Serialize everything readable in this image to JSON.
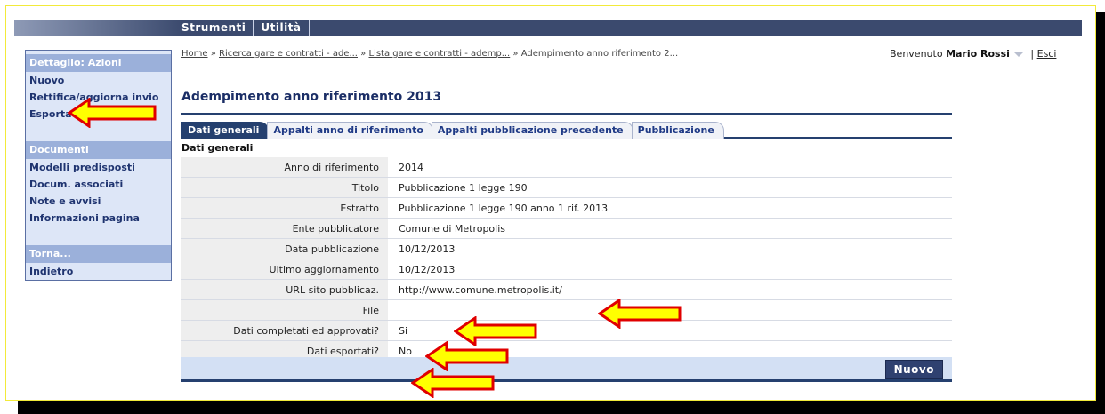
{
  "topmenu": {
    "strumenti": "Strumenti",
    "utilita": "Utilità"
  },
  "sidebar": {
    "azioni_title": "Dettaglio: Azioni",
    "azioni": [
      "Nuovo",
      "Rettifica/aggiorna invio",
      "Esporta dati"
    ],
    "documenti_title": "Documenti",
    "documenti": [
      "Modelli predisposti",
      "Docum. associati",
      "Note e avvisi",
      "Informazioni pagina"
    ],
    "torna_title": "Torna...",
    "torna": [
      "Indietro"
    ]
  },
  "breadcrumb": {
    "home": "Home",
    "sep": " » ",
    "link1": "Ricerca gare e contratti - ade...",
    "link2": "Lista gare e contratti - ademp...",
    "current": "Adempimento anno riferimento 2..."
  },
  "user": {
    "welcome": "Benvenuto",
    "name": "Mario Rossi",
    "sep": "|",
    "logout": "Esci"
  },
  "page_title": "Adempimento anno riferimento 2013",
  "tabs": [
    "Dati generali",
    "Appalti anno di riferimento",
    "Appalti pubblicazione precedente",
    "Pubblicazione"
  ],
  "section_title": "Dati generali",
  "rows": [
    {
      "label": "Anno di riferimento",
      "value": "2014"
    },
    {
      "label": "Titolo",
      "value": "Pubblicazione 1 legge 190"
    },
    {
      "label": "Estratto",
      "value": "Pubblicazione 1 legge 190 anno 1 rif. 2013"
    },
    {
      "label": "Ente pubblicatore",
      "value": "Comune di Metropolis"
    },
    {
      "label": "Data pubblicazione",
      "value": "10/12/2013"
    },
    {
      "label": "Ultimo aggiornamento",
      "value": "10/12/2013"
    },
    {
      "label": "URL sito pubblicaz.",
      "value": "http://www.comune.metropolis.it/"
    },
    {
      "label": "File",
      "value": ""
    },
    {
      "label": "Dati completati ed approvati?",
      "value": "Si"
    },
    {
      "label": "Dati esportati?",
      "value": "No"
    }
  ],
  "buttons": {
    "nuovo": "Nuovo"
  },
  "colors": {
    "accent": "#25406f",
    "annotation_fill": "#ffff00",
    "annotation_stroke": "#e00000"
  }
}
